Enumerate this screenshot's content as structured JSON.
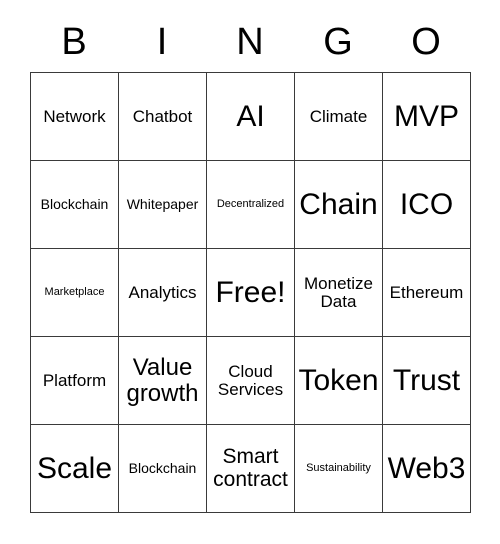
{
  "card": {
    "title": "BINGO",
    "header_letters": [
      "B",
      "I",
      "N",
      "G",
      "O"
    ],
    "colors": {
      "background": "#ffffff",
      "text": "#000000",
      "border": "#3a3a3a"
    },
    "grid_size": "5x5",
    "free_space_label": "Free!",
    "rows": [
      [
        {
          "label": "Network",
          "size": "fs-md"
        },
        {
          "label": "Chatbot",
          "size": "fs-md"
        },
        {
          "label": "AI",
          "size": "fs-xxl"
        },
        {
          "label": "Climate",
          "size": "fs-md"
        },
        {
          "label": "MVP",
          "size": "fs-xxl"
        }
      ],
      [
        {
          "label": "Blockchain",
          "size": "fs-sm"
        },
        {
          "label": "Whitepaper",
          "size": "fs-sm"
        },
        {
          "label": "Decentralized",
          "size": "fs-xs"
        },
        {
          "label": "Chain",
          "size": "fs-xxl"
        },
        {
          "label": "ICO",
          "size": "fs-xxl"
        }
      ],
      [
        {
          "label": "Marketplace",
          "size": "fs-xs"
        },
        {
          "label": "Analytics",
          "size": "fs-md"
        },
        {
          "label": "Free!",
          "size": "fs-xxl"
        },
        {
          "label": "Monetize Data",
          "size": "fs-md"
        },
        {
          "label": "Ethereum",
          "size": "fs-md"
        }
      ],
      [
        {
          "label": "Platform",
          "size": "fs-md"
        },
        {
          "label": "Value growth",
          "size": "fs-xl"
        },
        {
          "label": "Cloud Services",
          "size": "fs-md"
        },
        {
          "label": "Token",
          "size": "fs-xxl"
        },
        {
          "label": "Trust",
          "size": "fs-xxl"
        }
      ],
      [
        {
          "label": "Scale",
          "size": "fs-xxl"
        },
        {
          "label": "Blockchain",
          "size": "fs-sm"
        },
        {
          "label": "Smart contract",
          "size": "fs-lg"
        },
        {
          "label": "Sustainability",
          "size": "fs-xs"
        },
        {
          "label": "Web3",
          "size": "fs-xxl"
        }
      ]
    ]
  }
}
